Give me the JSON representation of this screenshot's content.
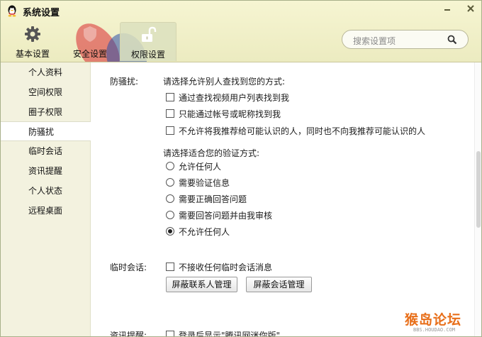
{
  "window": {
    "title": "系统设置"
  },
  "nav": {
    "tabs": [
      {
        "label": "基本设置"
      },
      {
        "label": "安全设置"
      },
      {
        "label": "权限设置",
        "selected": true
      }
    ]
  },
  "search": {
    "placeholder": "搜索设置项"
  },
  "sidebar": {
    "items": [
      {
        "label": "个人资料"
      },
      {
        "label": "空间权限"
      },
      {
        "label": "圈子权限"
      },
      {
        "label": "防骚扰",
        "selected": true
      },
      {
        "label": "临时会话"
      },
      {
        "label": "资讯提醒"
      },
      {
        "label": "个人状态"
      },
      {
        "label": "远程桌面"
      }
    ]
  },
  "main": {
    "anti_harass": {
      "label": "防骚扰:",
      "find_prompt": "请选择允许别人查找到您的方式:",
      "find_options": [
        {
          "label": "通过查找视频用户列表找到我",
          "checked": false
        },
        {
          "label": "只能通过帐号或昵称找到我",
          "checked": false
        },
        {
          "label": "不允许将我推荐给可能认识的人，同时也不向我推荐可能认识的人",
          "checked": false
        }
      ],
      "verify_prompt": "请选择适合您的验证方式:",
      "verify_options": [
        {
          "label": "允许任何人",
          "selected": false
        },
        {
          "label": "需要验证信息",
          "selected": false
        },
        {
          "label": "需要正确回答问题",
          "selected": false
        },
        {
          "label": "需要回答问题并由我审核",
          "selected": false
        },
        {
          "label": "不允许任何人",
          "selected": true
        }
      ]
    },
    "temp_session": {
      "label": "临时会话:",
      "option": {
        "label": "不接收任何临时会话消息",
        "checked": false
      },
      "btn_contacts": "屏蔽联系人管理",
      "btn_sessions": "屏蔽会话管理"
    },
    "news": {
      "label": "资讯提醒:",
      "option": {
        "label": "登录后显示\"腾讯网迷你版\"",
        "checked": false
      }
    }
  },
  "watermark": {
    "main": "猴岛论坛",
    "sub": "BBS.HOUDAO.COM"
  },
  "colors": {
    "header_bg": "#eeedc6",
    "sidebar_bg": "#f3f2df",
    "brand_red": "#d8282f",
    "brand_blue": "#2b4fa8"
  }
}
